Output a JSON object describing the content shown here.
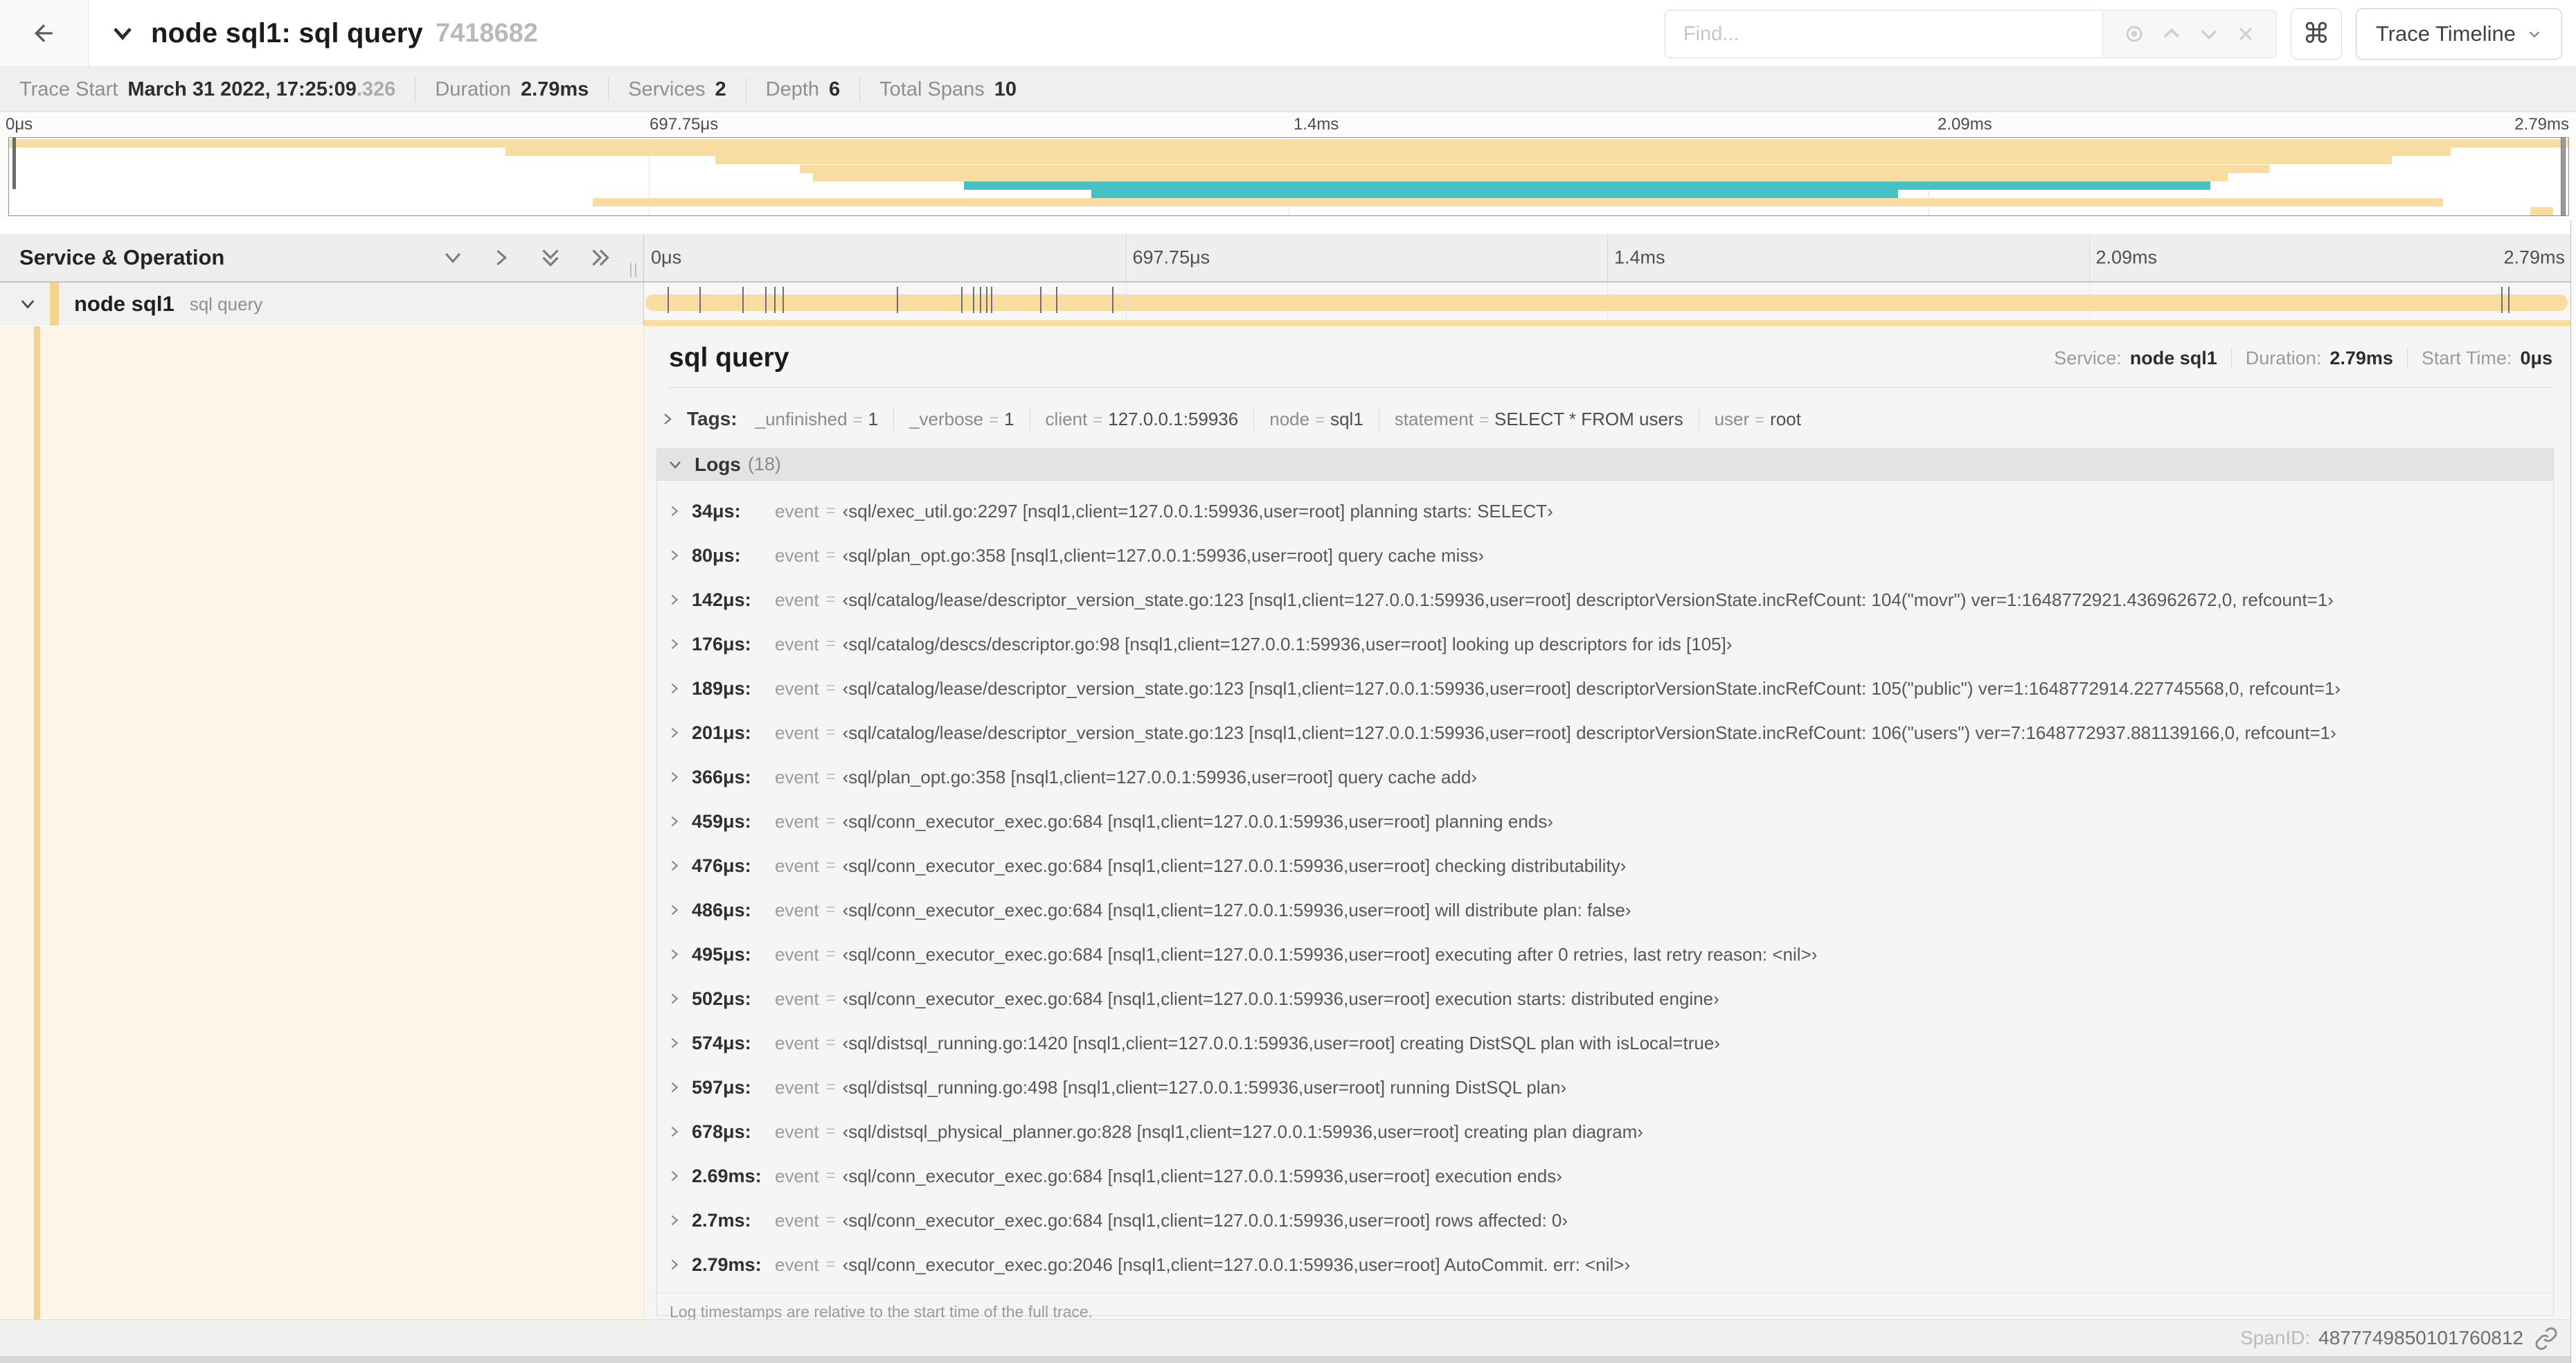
{
  "header": {
    "trace_title": "node sql1: sql query",
    "trace_id": "7418682",
    "find_placeholder": "Find...",
    "view_button_label": "Trace Timeline"
  },
  "meta": {
    "trace_start_label": "Trace Start",
    "trace_start_value": "March 31 2022, 17:25:09",
    "trace_start_ms": ".326",
    "duration_label": "Duration",
    "duration_value": "2.79ms",
    "services_label": "Services",
    "services_value": "2",
    "depth_label": "Depth",
    "depth_value": "6",
    "total_spans_label": "Total Spans",
    "total_spans_value": "10"
  },
  "timeline": {
    "ticks": [
      {
        "label": "0μs",
        "pos": 0
      },
      {
        "label": "697.75μs",
        "pos": 25
      },
      {
        "label": "1.4ms",
        "pos": 50
      },
      {
        "label": "2.09ms",
        "pos": 75
      },
      {
        "label": "2.79ms",
        "pos": 100
      }
    ],
    "total_us": 2790,
    "colors": {
      "tan": "#F8DCA2",
      "teal": "#47C1C4"
    },
    "minimap_rows": [
      {
        "color": "tan",
        "start": 0,
        "end": 100
      },
      {
        "color": "tan",
        "start": 19.4,
        "end": 95.4
      },
      {
        "color": "tan",
        "start": 27.6,
        "end": 93.1
      },
      {
        "color": "tan",
        "start": 30.9,
        "end": 88.3
      },
      {
        "color": "tan",
        "start": 31.4,
        "end": 86.7
      },
      {
        "color": "teal",
        "start": 37.3,
        "end": 86.0
      },
      {
        "color": "teal",
        "start": 42.3,
        "end": 73.8
      },
      {
        "color": "tan",
        "start": 22.8,
        "end": 95.1
      },
      {
        "color": "tan",
        "start": 98.5,
        "end": 99.4
      }
    ]
  },
  "grid": {
    "left_header": "Service & Operation"
  },
  "span_row": {
    "service": "node sql1",
    "operation": "sql query",
    "log_tick_times_us": [
      34,
      80,
      142,
      176,
      189,
      201,
      366,
      459,
      476,
      486,
      495,
      502,
      574,
      597,
      678,
      2690,
      2700
    ]
  },
  "detail": {
    "title": "sql query",
    "service_label": "Service:",
    "service_value": "node sql1",
    "duration_label": "Duration:",
    "duration_value": "2.79ms",
    "start_time_label": "Start Time:",
    "start_time_value": "0μs",
    "tags_label": "Tags:",
    "tags": [
      {
        "key": "_unfinished",
        "value": "1"
      },
      {
        "key": "_verbose",
        "value": "1"
      },
      {
        "key": "client",
        "value": "127.0.0.1:59936"
      },
      {
        "key": "node",
        "value": "sql1"
      },
      {
        "key": "statement",
        "value": "SELECT * FROM users"
      },
      {
        "key": "user",
        "value": "root"
      }
    ],
    "logs_label": "Logs",
    "logs_count": "(18)",
    "log_field": "event",
    "logs": [
      {
        "time": "34μs:",
        "value": "‹sql/exec_util.go:2297 [nsql1,client=127.0.0.1:59936,user=root] planning starts: SELECT›"
      },
      {
        "time": "80μs:",
        "value": "‹sql/plan_opt.go:358 [nsql1,client=127.0.0.1:59936,user=root] query cache miss›"
      },
      {
        "time": "142μs:",
        "value": "‹sql/catalog/lease/descriptor_version_state.go:123 [nsql1,client=127.0.0.1:59936,user=root] descriptorVersionState.incRefCount: 104(\"movr\") ver=1:1648772921.436962672,0, refcount=1›"
      },
      {
        "time": "176μs:",
        "value": "‹sql/catalog/descs/descriptor.go:98 [nsql1,client=127.0.0.1:59936,user=root] looking up descriptors for ids [105]›"
      },
      {
        "time": "189μs:",
        "value": "‹sql/catalog/lease/descriptor_version_state.go:123 [nsql1,client=127.0.0.1:59936,user=root] descriptorVersionState.incRefCount: 105(\"public\") ver=1:1648772914.227745568,0, refcount=1›"
      },
      {
        "time": "201μs:",
        "value": "‹sql/catalog/lease/descriptor_version_state.go:123 [nsql1,client=127.0.0.1:59936,user=root] descriptorVersionState.incRefCount: 106(\"users\") ver=7:1648772937.881139166,0, refcount=1›"
      },
      {
        "time": "366μs:",
        "value": "‹sql/plan_opt.go:358 [nsql1,client=127.0.0.1:59936,user=root] query cache add›"
      },
      {
        "time": "459μs:",
        "value": "‹sql/conn_executor_exec.go:684 [nsql1,client=127.0.0.1:59936,user=root] planning ends›"
      },
      {
        "time": "476μs:",
        "value": "‹sql/conn_executor_exec.go:684 [nsql1,client=127.0.0.1:59936,user=root] checking distributability›"
      },
      {
        "time": "486μs:",
        "value": "‹sql/conn_executor_exec.go:684 [nsql1,client=127.0.0.1:59936,user=root] will distribute plan: false›"
      },
      {
        "time": "495μs:",
        "value": "‹sql/conn_executor_exec.go:684 [nsql1,client=127.0.0.1:59936,user=root] executing after 0 retries, last retry reason: <nil>›"
      },
      {
        "time": "502μs:",
        "value": "‹sql/conn_executor_exec.go:684 [nsql1,client=127.0.0.1:59936,user=root] execution starts: distributed engine›"
      },
      {
        "time": "574μs:",
        "value": "‹sql/distsql_running.go:1420 [nsql1,client=127.0.0.1:59936,user=root] creating DistSQL plan with isLocal=true›"
      },
      {
        "time": "597μs:",
        "value": "‹sql/distsql_running.go:498 [nsql1,client=127.0.0.1:59936,user=root] running DistSQL plan›"
      },
      {
        "time": "678μs:",
        "value": "‹sql/distsql_physical_planner.go:828 [nsql1,client=127.0.0.1:59936,user=root] creating plan diagram›"
      },
      {
        "time": "2.69ms:",
        "value": "‹sql/conn_executor_exec.go:684 [nsql1,client=127.0.0.1:59936,user=root] execution ends›"
      },
      {
        "time": "2.7ms:",
        "value": "‹sql/conn_executor_exec.go:684 [nsql1,client=127.0.0.1:59936,user=root] rows affected: 0›"
      },
      {
        "time": "2.79ms:",
        "value": "‹sql/conn_executor_exec.go:2046 [nsql1,client=127.0.0.1:59936,user=root] AutoCommit. err: <nil>›"
      }
    ],
    "logs_footnote": "Log timestamps are relative to the start time of the full trace.",
    "span_id_label": "SpanID:",
    "span_id_value": "4877749850101760812"
  }
}
